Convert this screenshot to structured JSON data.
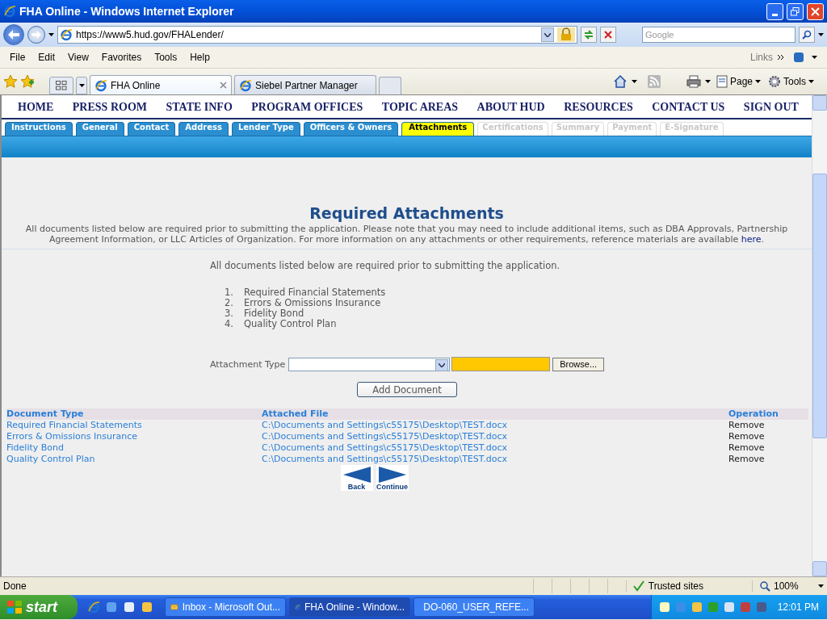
{
  "window": {
    "title": "FHA Online - Windows Internet Explorer"
  },
  "address_bar": {
    "url": "https://www5.hud.gov/FHALender/",
    "search_placeholder": "Google"
  },
  "menu": [
    "File",
    "Edit",
    "View",
    "Favorites",
    "Tools",
    "Help"
  ],
  "links_label": "Links",
  "browser_tabs": [
    {
      "label": "FHA Online",
      "selected": true
    },
    {
      "label": "Siebel Partner Manager",
      "selected": false
    }
  ],
  "command_bar": {
    "page": "Page",
    "tools": "Tools"
  },
  "site_nav": [
    "HOME",
    "PRESS ROOM",
    "STATE INFO",
    "PROGRAM OFFICES",
    "TOPIC AREAS",
    "ABOUT HUD",
    "RESOURCES",
    "CONTACT US",
    "SIGN OUT"
  ],
  "steps": [
    {
      "label": "Instructions",
      "selected": false,
      "disabled": false
    },
    {
      "label": "General",
      "selected": false,
      "disabled": false
    },
    {
      "label": "Contact",
      "selected": false,
      "disabled": false
    },
    {
      "label": "Address",
      "selected": false,
      "disabled": false
    },
    {
      "label": "Lender Type",
      "selected": false,
      "disabled": false
    },
    {
      "label": "Officers & Owners",
      "selected": false,
      "disabled": false
    },
    {
      "label": "Attachments",
      "selected": true,
      "disabled": false
    },
    {
      "label": "Certifications",
      "selected": false,
      "disabled": true
    },
    {
      "label": "Summary",
      "selected": false,
      "disabled": true
    },
    {
      "label": "Payment",
      "selected": false,
      "disabled": true
    },
    {
      "label": "E-Signature",
      "selected": false,
      "disabled": true
    }
  ],
  "page": {
    "title": "Required Attachments",
    "intro": "All documents listed below are required prior to submitting the application. Please note that you may need to include additional items, such as DBA Approvals, Partnership Agreement Information, or LLC Articles of Organization. For more information on any attachments or other requirements, reference materials are available",
    "intro_link": "here",
    "intro_end": ".",
    "note": "All documents listed below are required prior to submitting the application."
  },
  "required_list": [
    {
      "number": "1.",
      "text": "Required Financial Statements"
    },
    {
      "number": "2.",
      "text": "Errors & Omissions Insurance"
    },
    {
      "number": "3.",
      "text": "Fidelity Bond"
    },
    {
      "number": "4.",
      "text": "Quality Control Plan"
    }
  ],
  "form": {
    "label": "Attachment Type",
    "browse": "Browse...",
    "add": "Add Document"
  },
  "table": {
    "columns": [
      "Document Type",
      "Attached File",
      "Operation"
    ],
    "rows": [
      {
        "document_type": "Required Financial Statements",
        "attached_file": "C:\\Documents and Settings\\c55175\\Desktop\\TEST.docx",
        "operation": "Remove"
      },
      {
        "document_type": "Errors & Omissions Insurance",
        "attached_file": "C:\\Documents and Settings\\c55175\\Desktop\\TEST.docx",
        "operation": "Remove"
      },
      {
        "document_type": "Fidelity Bond",
        "attached_file": "C:\\Documents and Settings\\c55175\\Desktop\\TEST.docx",
        "operation": "Remove"
      },
      {
        "document_type": "Quality Control Plan",
        "attached_file": "C:\\Documents and Settings\\c55175\\Desktop\\TEST.docx",
        "operation": "Remove"
      }
    ]
  },
  "nav_buttons": [
    {
      "label": "Back",
      "kind": "back"
    },
    {
      "label": "Continue",
      "kind": "next"
    }
  ],
  "status_bar": {
    "text": "Done",
    "zone": "Trusted sites",
    "zoom": "100%"
  },
  "taskbar": {
    "start": "start",
    "windows": [
      {
        "label": "Inbox - Microsoft Out...",
        "selected": false,
        "kind": "mail"
      },
      {
        "label": "FHA Online - Window...",
        "selected": true,
        "kind": "browser"
      },
      {
        "label": "DO-060_USER_REFE...",
        "selected": false,
        "kind": "document"
      }
    ],
    "clock": "12:01 PM"
  }
}
